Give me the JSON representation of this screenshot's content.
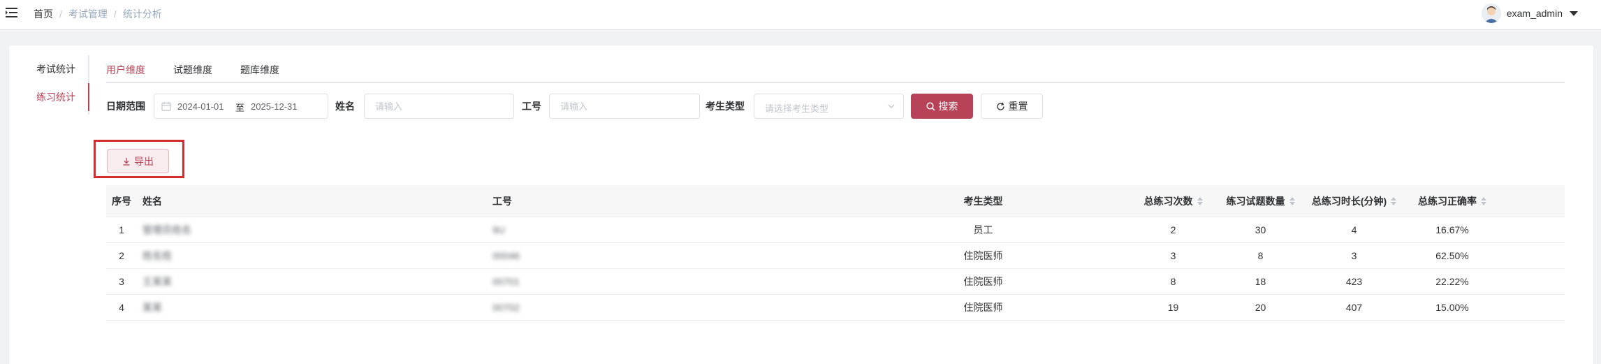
{
  "breadcrumb": [
    "首页",
    "考试管理",
    "统计分析"
  ],
  "user": {
    "name": "exam_admin"
  },
  "vertical_tabs": [
    {
      "label": "考试统计",
      "active": false
    },
    {
      "label": "练习统计",
      "active": true
    }
  ],
  "horizontal_tabs": [
    {
      "label": "用户维度",
      "active": true
    },
    {
      "label": "试题维度",
      "active": false
    },
    {
      "label": "题库维度",
      "active": false
    }
  ],
  "filters": {
    "date_label": "日期范围",
    "date_start": "2024-01-01",
    "date_separator": "至",
    "date_end": "2025-12-31",
    "name_label": "姓名",
    "name_placeholder": "请输入",
    "id_label": "工号",
    "id_placeholder": "请输入",
    "type_label": "考生类型",
    "type_placeholder": "请选择考生类型",
    "search_button": "搜索",
    "reset_button": "重置"
  },
  "export_button": "导出",
  "table": {
    "headers": {
      "index": "序号",
      "name": "姓名",
      "id": "工号",
      "type": "考生类型",
      "total_count": "总练习次数",
      "question_count": "练习试题数量",
      "duration": "总练习时长(分钟)",
      "accuracy": "总练习正确率"
    },
    "rows": [
      {
        "index": "1",
        "name": "管理员姓名",
        "id": "9U",
        "type": "员工",
        "total_count": "2",
        "question_count": "30",
        "duration": "4",
        "accuracy": "16.67%"
      },
      {
        "index": "2",
        "name": "姓名姓",
        "id": "00046",
        "type": "住院医师",
        "total_count": "3",
        "question_count": "8",
        "duration": "3",
        "accuracy": "62.50%"
      },
      {
        "index": "3",
        "name": "王某某",
        "id": "00701",
        "type": "住院医师",
        "total_count": "8",
        "question_count": "18",
        "duration": "423",
        "accuracy": "22.22%"
      },
      {
        "index": "4",
        "name": "某某",
        "id": "00702",
        "type": "住院医师",
        "total_count": "19",
        "question_count": "20",
        "duration": "407",
        "accuracy": "15.00%"
      }
    ]
  },
  "colors": {
    "accent": "#b84257",
    "highlight_border": "#d42d2d"
  }
}
